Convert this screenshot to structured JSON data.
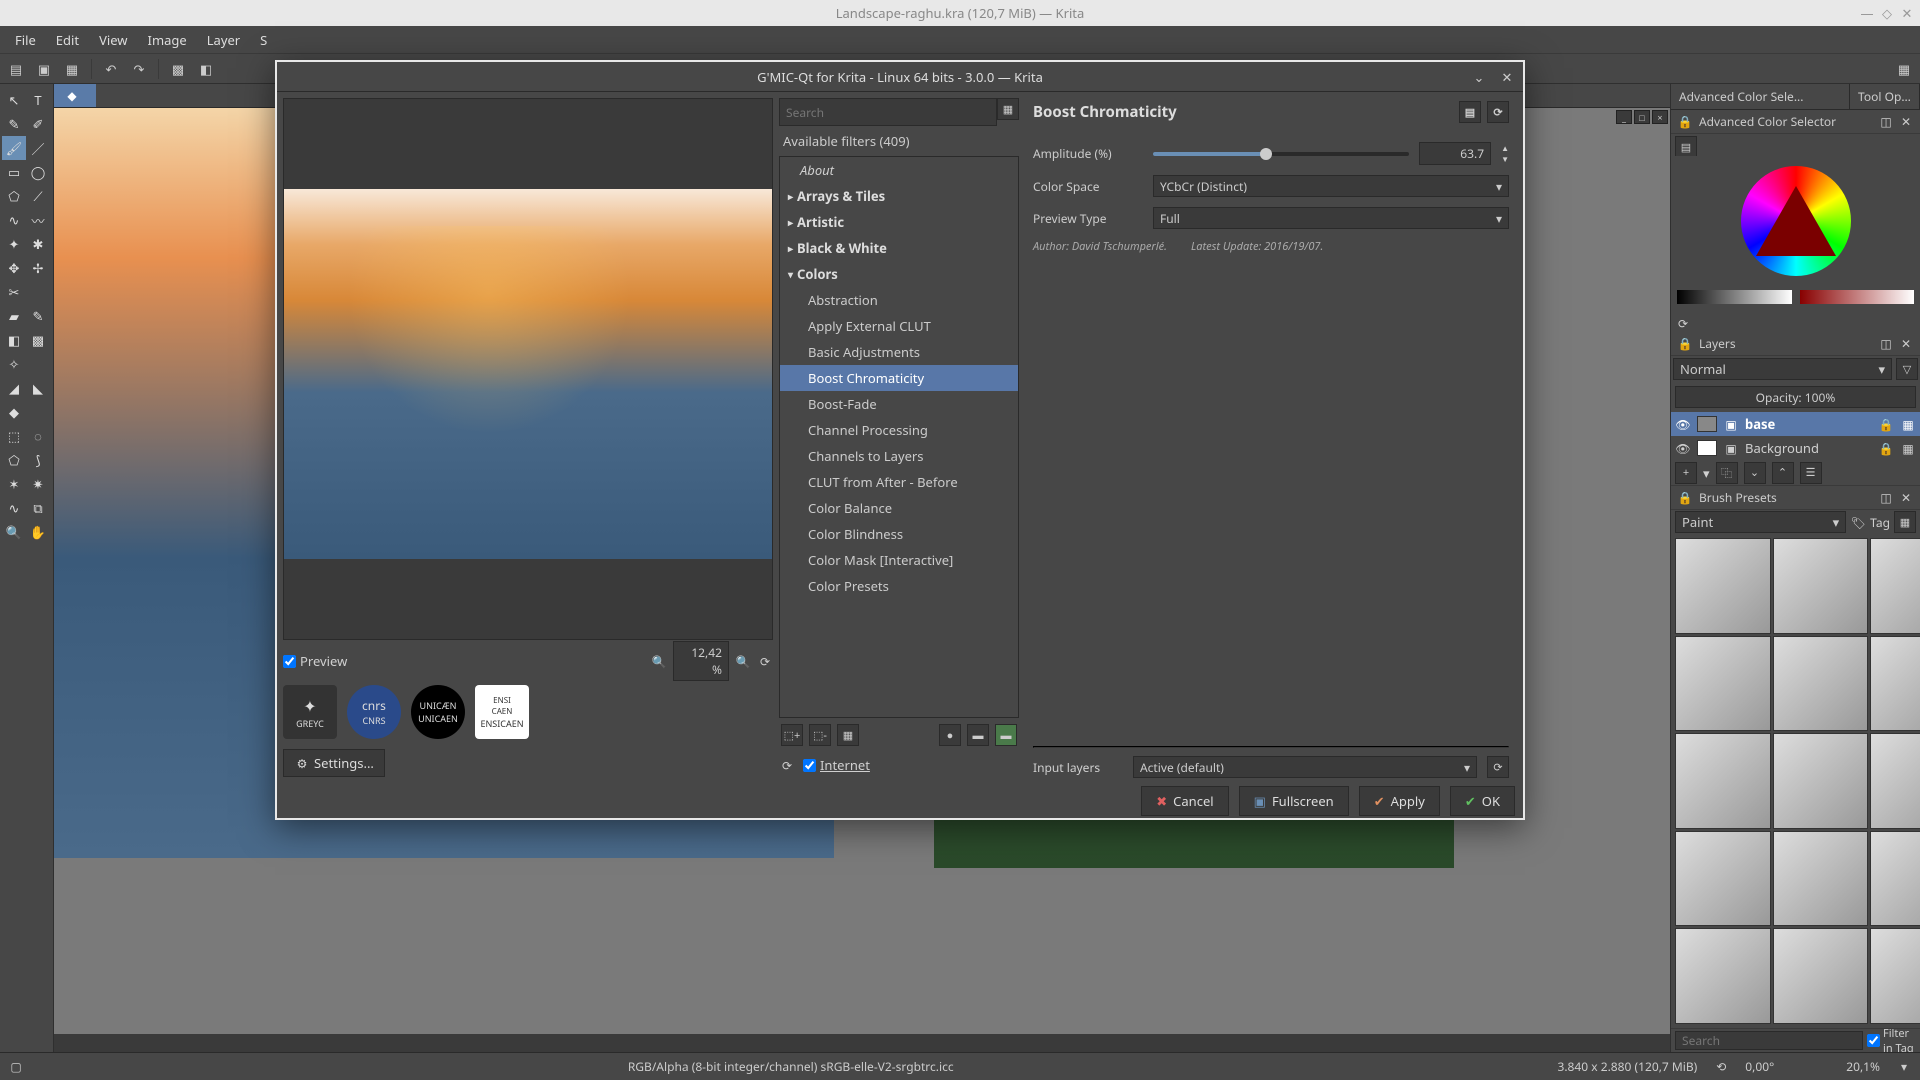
{
  "outer_window": {
    "title": "Landscape-raghu.kra (120,7 MiB) — Krita"
  },
  "menubar": [
    "File",
    "Edit",
    "View",
    "Image",
    "Layer",
    "S"
  ],
  "canvas_tab": {
    "label": ""
  },
  "gmic": {
    "title": "G'MIC-Qt for Krita - Linux 64 bits - 3.0.0 — Krita",
    "search_placeholder": "Search",
    "available_filters": "Available filters (409)",
    "categories": {
      "about": "About",
      "arrays": "Arrays & Tiles",
      "artistic": "Artistic",
      "bw": "Black & White",
      "colors": "Colors"
    },
    "color_filters": [
      "Abstraction",
      "Apply External CLUT",
      "Basic Adjustments",
      "Boost Chromaticity",
      "Boost-Fade",
      "Channel Processing",
      "Channels to Layers",
      "CLUT from After - Before",
      "Color Balance",
      "Color Blindness",
      "Color Mask [Interactive]",
      "Color Presets"
    ],
    "selected_filter": "Boost Chromaticity",
    "preview_label": "Preview",
    "zoom": "12,42 %",
    "internet_label": "Internet",
    "logos": [
      "GREYC",
      "CNRS",
      "UNICAEN",
      "ENSICAEN"
    ],
    "settings_label": "Settings...",
    "filter_title": "Boost Chromaticity",
    "params": {
      "amplitude_label": "Amplitude (%)",
      "amplitude_value": "63.7",
      "colorspace_label": "Color Space",
      "colorspace_value": "YCbCr (Distinct)",
      "previewtype_label": "Preview Type",
      "previewtype_value": "Full"
    },
    "meta": {
      "author_label": "Author: ",
      "author": "David Tschumperlé.",
      "update_label": "Latest Update: ",
      "update": "2016/19/07."
    },
    "input_layers_label": "Input layers",
    "input_layers_value": "Active (default)",
    "buttons": {
      "cancel": "Cancel",
      "fullscreen": "Fullscreen",
      "apply": "Apply",
      "ok": "OK"
    }
  },
  "right": {
    "color_tab1": "Advanced Color Sele...",
    "color_tab2": "Tool Opt...",
    "color_header": "Advanced Color Selector",
    "layers_header": "Layers",
    "blend_mode": "Normal",
    "opacity": "Opacity:  100%",
    "layers": [
      {
        "name": "base",
        "selected": true
      },
      {
        "name": "Background",
        "selected": false
      }
    ],
    "brush_header": "Brush Presets",
    "brush_tag": "Paint",
    "tag_label": "Tag",
    "brush_search_placeholder": "Search",
    "filter_in_tag": "Filter in Tag"
  },
  "statusbar": {
    "colorspace": "RGB/Alpha (8-bit integer/channel)  sRGB-elle-V2-srgbtrc.icc",
    "dimensions": "3.840 x 2.880 (120,7 MiB)",
    "angle": "0,00°",
    "zoom": "20,1%"
  }
}
